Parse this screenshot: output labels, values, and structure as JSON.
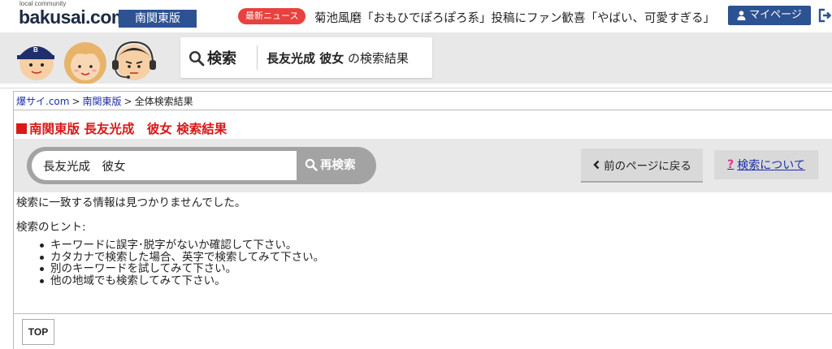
{
  "topbar": {
    "logo_small": "local community",
    "logo": "bakusai.com",
    "region": "南関東版",
    "news_badge": "最新ニュース",
    "news_headline": "菊池風磨「おもひでぽろぽろ系」投稿にファン歓喜「やばい、可愛すぎる」",
    "mypage_label": "マイページ",
    "icons": {
      "mypage": "person-icon",
      "logout": "logout-icon"
    }
  },
  "header": {
    "search_label": "検索",
    "query_bold": "長友光成 彼女",
    "result_suffix": "の検索結果",
    "icons": {
      "search": "magnifier-icon",
      "mascots": "mascot-characters"
    }
  },
  "breadcrumb": {
    "items": [
      "爆サイ.com",
      "南関東版",
      "全体検索結果"
    ],
    "separator": ">"
  },
  "page_title": "南関東版 長友光成　彼女 検索結果",
  "search": {
    "value": "長友光成　彼女",
    "button_label": "再検索",
    "back_label": "前のページに戻る",
    "about_label": "検索について",
    "about_icon": "?"
  },
  "results": {
    "no_result_message": "検索に一致する情報は見つかりませんでした。",
    "hint_label": "検索のヒント:",
    "hints": [
      "キーワードに誤字･脱字がないか確認して下さい。",
      "カタカナで検索した場合、英字で検索してみて下さい。",
      "別のキーワードを試してみて下さい。",
      "他の地域でも検索してみて下さい。"
    ]
  },
  "footer": {
    "top_label": "TOP"
  },
  "colors": {
    "brand_navy": "#2d5291",
    "news_red": "#e8413f",
    "title_red": "#d91818",
    "link_blue": "#1a2fa8",
    "panel_gray": "#e8e8e8"
  }
}
